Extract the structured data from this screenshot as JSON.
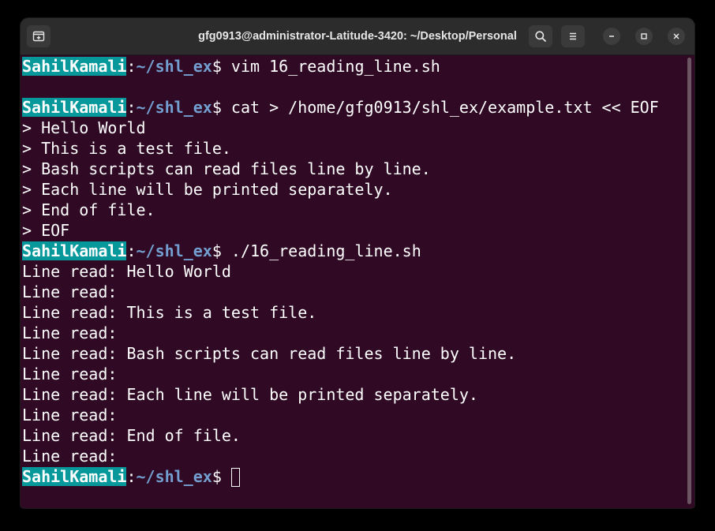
{
  "window": {
    "title": "gfg0913@administrator-Latitude-3420: ~/Desktop/Personal"
  },
  "titlebar": {
    "icons": {
      "new_tab": "new-tab-icon",
      "search": "search-icon",
      "menu": "hamburger-menu-icon",
      "minimize": "minimize-icon",
      "maximize": "maximize-icon",
      "close": "close-icon"
    }
  },
  "prompt": {
    "user": "SahilKamali",
    "colon": ":",
    "path": "~/shl_ex",
    "dollar": "$"
  },
  "colors": {
    "background": "#300a24",
    "user_bg": "#06989a",
    "path": "#729fcf",
    "text": "#ffffff"
  },
  "lines": [
    {
      "type": "prompt",
      "command": "vim 16_reading_line.sh"
    },
    {
      "type": "text",
      "text": ""
    },
    {
      "type": "prompt",
      "command": "cat > /home/gfg0913/shl_ex/example.txt << EOF"
    },
    {
      "type": "text",
      "text": "> Hello World"
    },
    {
      "type": "text",
      "text": "> This is a test file."
    },
    {
      "type": "text",
      "text": "> Bash scripts can read files line by line."
    },
    {
      "type": "text",
      "text": "> Each line will be printed separately."
    },
    {
      "type": "text",
      "text": "> End of file."
    },
    {
      "type": "text",
      "text": "> EOF"
    },
    {
      "type": "prompt",
      "command": "./16_reading_line.sh"
    },
    {
      "type": "text",
      "text": "Line read: Hello World"
    },
    {
      "type": "text",
      "text": "Line read:"
    },
    {
      "type": "text",
      "text": "Line read: This is a test file."
    },
    {
      "type": "text",
      "text": "Line read:"
    },
    {
      "type": "text",
      "text": "Line read: Bash scripts can read files line by line."
    },
    {
      "type": "text",
      "text": "Line read:"
    },
    {
      "type": "text",
      "text": "Line read: Each line will be printed separately."
    },
    {
      "type": "text",
      "text": "Line read:"
    },
    {
      "type": "text",
      "text": "Line read: End of file."
    },
    {
      "type": "text",
      "text": "Line read:"
    },
    {
      "type": "prompt-cursor",
      "command": ""
    }
  ]
}
